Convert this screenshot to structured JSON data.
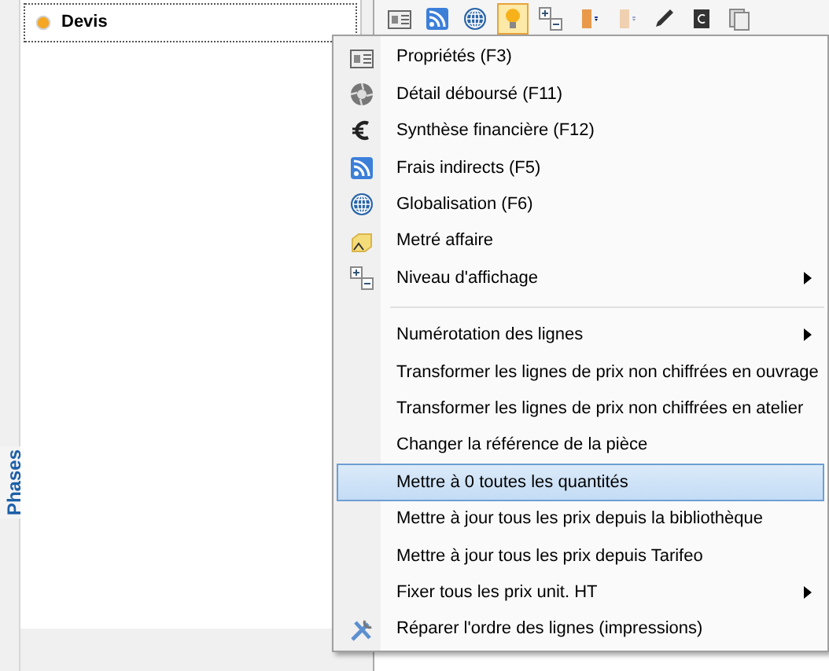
{
  "tree": [
    {
      "label": "Devis",
      "focused": true
    }
  ],
  "side_tab": {
    "label": "Phases"
  },
  "toolbar": [
    {
      "selected": false,
      "disabled": false
    },
    {
      "selected": false,
      "disabled": false
    },
    {
      "selected": false,
      "disabled": false
    },
    {
      "selected": true,
      "disabled": false
    },
    {
      "selected": false,
      "disabled": false
    },
    {
      "selected": false,
      "disabled": false
    },
    {
      "selected": false,
      "disabled": true
    },
    {
      "selected": false,
      "disabled": false
    },
    {
      "selected": false,
      "disabled": false
    },
    {
      "selected": false,
      "disabled": false
    }
  ],
  "context_menu": [
    {
      "kind": "item",
      "label": "Propriétés (F3)",
      "submenu": false,
      "selected": false
    },
    {
      "kind": "item",
      "label": "Détail déboursé (F11)",
      "submenu": false,
      "selected": false
    },
    {
      "kind": "item",
      "label": "Synthèse financière (F12)",
      "submenu": false,
      "selected": false
    },
    {
      "kind": "item",
      "label": "Frais indirects (F5)",
      "submenu": false,
      "selected": false
    },
    {
      "kind": "item",
      "label": "Globalisation (F6)",
      "submenu": false,
      "selected": false
    },
    {
      "kind": "item",
      "label": "Metré affaire",
      "submenu": false,
      "selected": false
    },
    {
      "kind": "item",
      "label": "Niveau d'affichage",
      "submenu": true,
      "selected": false
    },
    {
      "kind": "separator"
    },
    {
      "kind": "item",
      "label": "Numérotation des lignes",
      "submenu": true,
      "selected": false
    },
    {
      "kind": "item",
      "label": "Transformer les lignes de prix non chiffrées en ouvrage",
      "submenu": false,
      "selected": false
    },
    {
      "kind": "item",
      "label": "Transformer les lignes de prix non chiffrées en atelier",
      "submenu": false,
      "selected": false
    },
    {
      "kind": "item",
      "label": "Changer la référence de la pièce",
      "submenu": false,
      "selected": false
    },
    {
      "kind": "item",
      "label": "Mettre à 0 toutes les quantités",
      "submenu": false,
      "selected": true
    },
    {
      "kind": "item",
      "label": "Mettre à jour tous les prix depuis la bibliothèque",
      "submenu": false,
      "selected": false
    },
    {
      "kind": "item",
      "label": "Mettre à jour tous les prix depuis Tarifeo",
      "submenu": false,
      "selected": false
    },
    {
      "kind": "item",
      "label": "Fixer tous les prix unit. HT",
      "submenu": true,
      "selected": false
    },
    {
      "kind": "item",
      "label": "Réparer l'ordre des lignes (impressions)",
      "submenu": false,
      "selected": false
    }
  ]
}
